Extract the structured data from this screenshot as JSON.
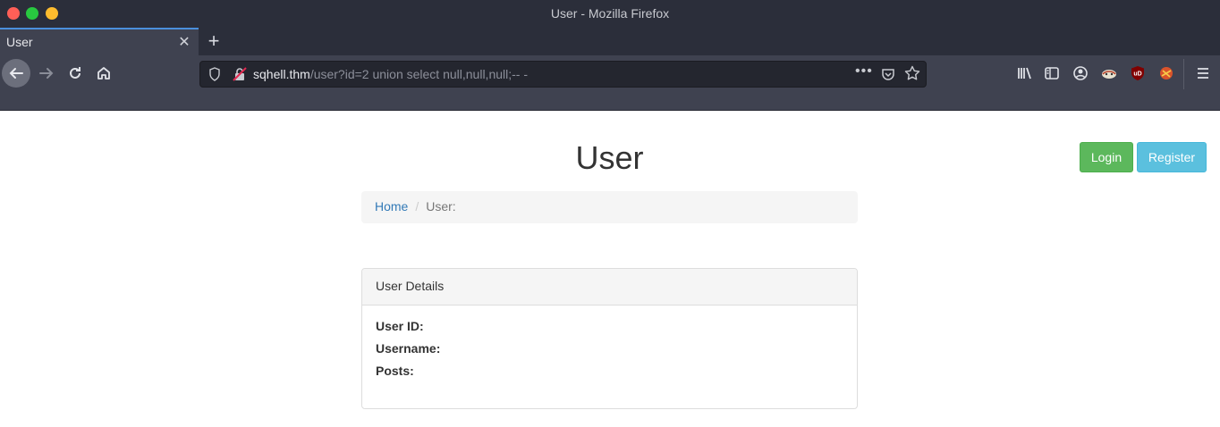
{
  "window": {
    "title": "User - Mozilla Firefox"
  },
  "tab": {
    "label": "User",
    "close_glyph": "✕",
    "new_tab_glyph": "+"
  },
  "urlbar": {
    "host": "sqhell.thm",
    "path": "/user?id=2 union select null,null,null;-- -",
    "page_actions_glyph": "•••"
  },
  "toolbar_icons": [
    "library-icon",
    "sidebar-icon",
    "account-icon",
    "extension-1-icon",
    "ublock-icon",
    "extension-3-icon",
    "menu-icon"
  ],
  "page": {
    "title": "User",
    "buttons": {
      "login": "Login",
      "register": "Register"
    },
    "breadcrumb": {
      "home": "Home",
      "separator": "/",
      "current": "User:"
    },
    "panel": {
      "heading": "User Details",
      "rows": [
        "User ID:",
        "Username:",
        "Posts:"
      ]
    }
  },
  "colors": {
    "login_green": "#5cb85c",
    "register_blue": "#5bc0de",
    "link_blue": "#337ab7"
  }
}
